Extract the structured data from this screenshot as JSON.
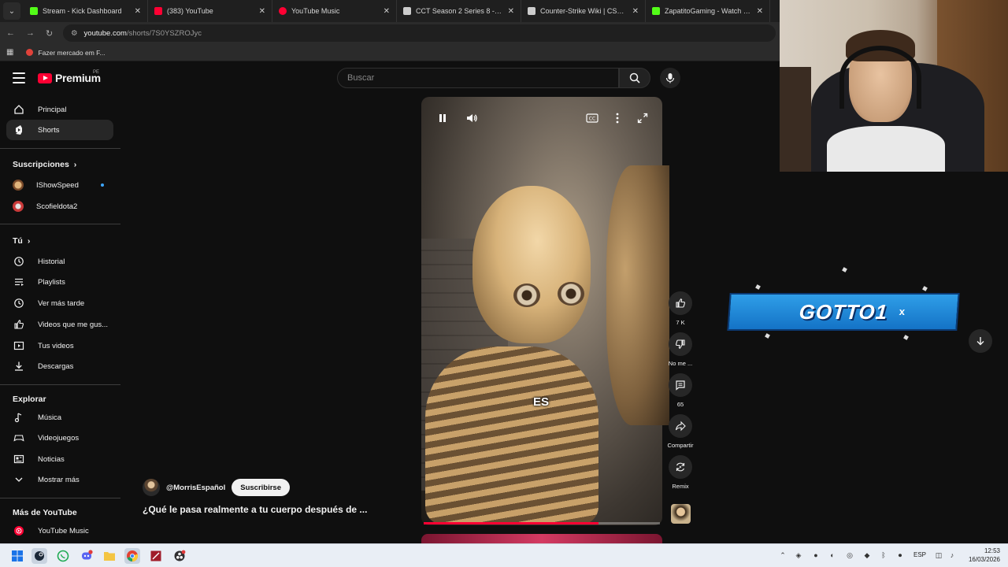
{
  "browser": {
    "tabs": [
      {
        "title": "Stream - Kick Dashboard",
        "color": "#53fc18"
      },
      {
        "title": "(383) YouTube",
        "color": "#ff0033"
      },
      {
        "title": "YouTube Music",
        "color": "#ff0033"
      },
      {
        "title": "CCT Season 2 Series 8 - Liquipedia",
        "color": "#cccccc"
      },
      {
        "title": "Counter-Strike Wiki | CS2 | Liquipedia",
        "color": "#cccccc"
      },
      {
        "title": "ZapatitoGaming - Watch clips on Kick",
        "color": "#53fc18"
      }
    ],
    "url_host": "youtube.com",
    "url_path": "/shorts/7S0YSZROJyc",
    "bookmark": "Fazer mercado em F..."
  },
  "header": {
    "logo_text": "Premium",
    "country": "PE",
    "search_placeholder": "Buscar"
  },
  "sidebar": {
    "main": [
      {
        "label": "Principal",
        "icon": "home-icon"
      },
      {
        "label": "Shorts",
        "icon": "shorts-icon"
      }
    ],
    "subscriptions_title": "Suscripciones",
    "subscriptions": [
      {
        "label": "IShowSpeed"
      },
      {
        "label": "Scofieldota2"
      }
    ],
    "you_title": "Tú",
    "you": [
      {
        "label": "Historial",
        "icon": "history-icon"
      },
      {
        "label": "Playlists",
        "icon": "playlist-icon"
      },
      {
        "label": "Ver más tarde",
        "icon": "clock-icon"
      },
      {
        "label": "Videos que me gus...",
        "icon": "thumbs-up-icon"
      },
      {
        "label": "Tus videos",
        "icon": "video-icon"
      },
      {
        "label": "Descargas",
        "icon": "download-icon"
      }
    ],
    "explore_title": "Explorar",
    "explore": [
      {
        "label": "Música",
        "icon": "music-icon"
      },
      {
        "label": "Videojuegos",
        "icon": "gamepad-icon"
      },
      {
        "label": "Noticias",
        "icon": "news-icon"
      },
      {
        "label": "Mostrar más",
        "icon": "chevron-down-icon"
      }
    ],
    "more_title": "Más de YouTube",
    "more": [
      {
        "label": "YouTube Music",
        "icon": "youtube-music-icon"
      }
    ]
  },
  "short": {
    "caption": "ES",
    "progress": 0.74,
    "channel": "@MorrisEspañol",
    "subscribe_label": "Suscribirse",
    "title": "¿Qué le pasa realmente a tu cuerpo después de ..."
  },
  "actions": {
    "likes": "7 K",
    "dislike": "No me ...",
    "comments": "65",
    "share": "Compartir",
    "remix": "Remix"
  },
  "overlay": {
    "banner_text": "GOTTO1",
    "banner_x": "x"
  },
  "taskbar": {
    "lang": "ESP",
    "time": "12:53",
    "date": "16/03/2026"
  }
}
